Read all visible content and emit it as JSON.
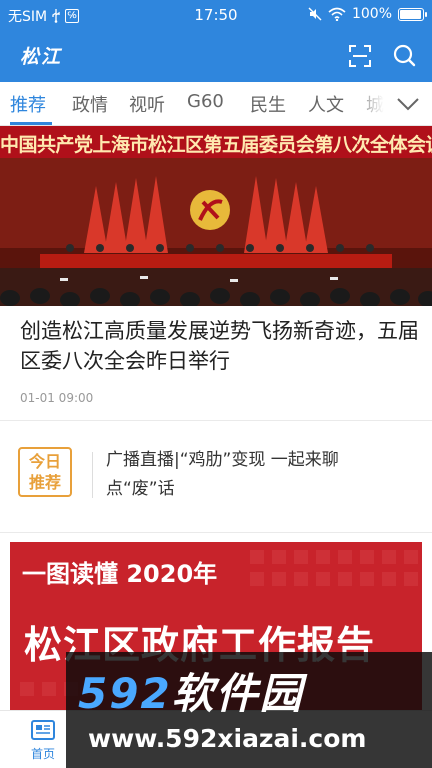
{
  "status_bar": {
    "carrier": "无SIM",
    "usb_icon": "usb-icon",
    "notification_badge": "℅",
    "time": "17:50",
    "mute_icon": "mute-icon",
    "wifi_icon": "wifi-icon",
    "battery_text": "100%",
    "battery_level": 1.0
  },
  "header": {
    "logo_text": "松江",
    "scan_icon": "scan-icon",
    "search_icon": "search-icon",
    "background_color": "#2f86dd"
  },
  "channels": {
    "tabs": [
      {
        "label": "推荐",
        "active": true
      },
      {
        "label": "政情"
      },
      {
        "label": "视听"
      },
      {
        "label": "G60"
      },
      {
        "label": "民生"
      },
      {
        "label": "人文"
      },
      {
        "label": "城"
      }
    ],
    "expand_icon": "chevron-down-icon"
  },
  "hero": {
    "banner_text": "中国共产党上海市松江区第五届委员会第八次全体会议",
    "image_desc_icon": "meeting-photo"
  },
  "article": {
    "title": "创造松江高质量发展逆势飞扬新奇迹，五届区委八次全会昨日举行",
    "time": "01-01 09:00"
  },
  "today": {
    "badge_line1": "今日",
    "badge_line2": "推荐",
    "text": "广播直播|“鸡肋”变现  一起来聊点“废”话"
  },
  "report_card": {
    "line1": "一图读懂 2020年",
    "line2": "松江区政府工作报告"
  },
  "bottom_nav": {
    "home_label": "首页",
    "home_icon": "news-icon"
  },
  "watermark": {
    "logo_num": "592",
    "logo_cn": "软件园",
    "url": "www.592xiazai.com"
  }
}
